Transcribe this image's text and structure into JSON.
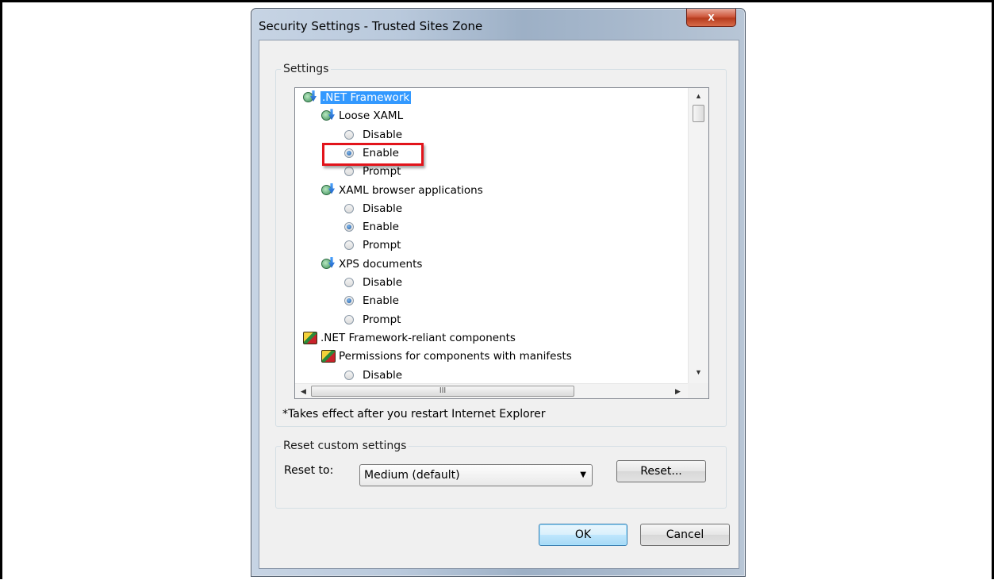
{
  "window": {
    "title": "Security Settings - Trusted Sites Zone",
    "close_glyph": "x"
  },
  "settings": {
    "group_label": "Settings",
    "tree": [
      {
        "type": "category",
        "icon": "net-framework-icon",
        "label": ".NET Framework",
        "selected": true,
        "indent": 0
      },
      {
        "type": "setting",
        "icon": "net-framework-icon",
        "label": "Loose XAML",
        "indent": 1
      },
      {
        "type": "option",
        "label": "Disable",
        "checked": false,
        "indent": 2
      },
      {
        "type": "option",
        "label": "Enable",
        "checked": true,
        "indent": 2,
        "highlighted": true
      },
      {
        "type": "option",
        "label": "Prompt",
        "checked": false,
        "indent": 2
      },
      {
        "type": "setting",
        "icon": "net-framework-icon",
        "label": "XAML browser applications",
        "indent": 1
      },
      {
        "type": "option",
        "label": "Disable",
        "checked": false,
        "indent": 2
      },
      {
        "type": "option",
        "label": "Enable",
        "checked": true,
        "indent": 2
      },
      {
        "type": "option",
        "label": "Prompt",
        "checked": false,
        "indent": 2
      },
      {
        "type": "setting",
        "icon": "net-framework-icon",
        "label": "XPS documents",
        "indent": 1
      },
      {
        "type": "option",
        "label": "Disable",
        "checked": false,
        "indent": 2
      },
      {
        "type": "option",
        "label": "Enable",
        "checked": true,
        "indent": 2
      },
      {
        "type": "option",
        "label": "Prompt",
        "checked": false,
        "indent": 2
      },
      {
        "type": "category",
        "icon": "components-icon",
        "label": ".NET Framework-reliant components",
        "indent": 0
      },
      {
        "type": "setting",
        "icon": "components-icon",
        "label": "Permissions for components with manifests",
        "indent": 1
      },
      {
        "type": "option",
        "label": "Disable",
        "checked": false,
        "indent": 2
      }
    ],
    "hscroll_grip": "III",
    "note": "*Takes effect after you restart Internet Explorer"
  },
  "reset": {
    "group_label": "Reset custom settings",
    "reset_to_label": "Reset to:",
    "selected_level": "Medium (default)",
    "reset_button": "Reset..."
  },
  "footer": {
    "ok": "OK",
    "cancel": "Cancel"
  }
}
